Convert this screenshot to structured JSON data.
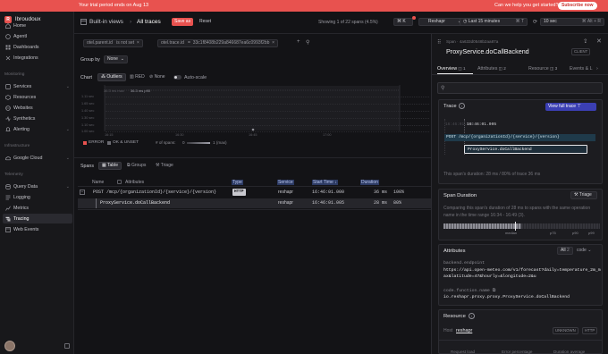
{
  "banner": {
    "message": "Your trial period ends on Aug 13",
    "question": "Can we help you get started?",
    "subscribe": "Subscribe now"
  },
  "sidebar": {
    "org_initial": "R",
    "org_name": "lbroudoux",
    "top_items": [
      {
        "label": "Home",
        "icon": "home-icon"
      },
      {
        "label": "AgentI",
        "icon": "agent-icon"
      },
      {
        "label": "Dashboards",
        "icon": "dashboard-icon"
      },
      {
        "label": "Integrations",
        "icon": "integrations-icon"
      }
    ],
    "monitoring_header": "Monitoring",
    "monitoring_items": [
      {
        "label": "Services",
        "icon": "services-icon",
        "chevron": "⌄"
      },
      {
        "label": "Resources",
        "icon": "resources-icon"
      },
      {
        "label": "Websites",
        "icon": "globe-icon"
      },
      {
        "label": "Synthetics",
        "icon": "synthetics-icon"
      },
      {
        "label": "Alerting",
        "icon": "bell-icon",
        "chevron": "⌄"
      }
    ],
    "infra_header": "Infrastructure",
    "infra_items": [
      {
        "label": "Google Cloud",
        "icon": "cloud-icon",
        "chevron": "⌄"
      }
    ],
    "telemetry_header": "Telemetry",
    "telemetry_items": [
      {
        "label": "Query Data",
        "icon": "database-icon",
        "chevron": "⌄"
      },
      {
        "label": "Logging",
        "icon": "logs-icon"
      },
      {
        "label": "Metrics",
        "icon": "metrics-icon"
      },
      {
        "label": "Tracing",
        "icon": "tracing-icon",
        "active": true
      },
      {
        "label": "Web Events",
        "icon": "web-events-icon"
      }
    ]
  },
  "topbar": {
    "views_label": "Built-in views",
    "crumb_sep": "›",
    "current_view": "All traces",
    "save_as": "Save as",
    "reset": "Reset",
    "showing": "Showing 1 of 22 spans (4.5%)",
    "kbd": "⌘ K",
    "project": "Reshapr",
    "time_range": "Last 15 minutes",
    "time_kbd": "⌘ T",
    "refresh": "10 sec",
    "refresh_kbd": "⌘ Alt + R"
  },
  "filters": {
    "f1_field": "otel.parent.id",
    "f1_op": "is not set",
    "f2_field": "otel.trace.id",
    "f2_op": "=",
    "f2_value": "33c1f8408b229a846687ea6c0993f2bb"
  },
  "groupby": {
    "label": "Group by",
    "value": "None"
  },
  "chart": {
    "label": "Chart",
    "modes": [
      "Outliers",
      "RED",
      "None"
    ],
    "autoscale": "Auto-scale",
    "y_ticks": [
      "1.11 sec",
      "1.65 sec",
      "1.40 sec",
      "1.30 sec",
      "1.10 sec",
      "1.00 sec"
    ],
    "x_ticks": [
      "16:15",
      "16:30",
      "16:45",
      "17:00"
    ],
    "annotation_p90": "36.3 ms p90",
    "annotation_left": "36.3 ms max",
    "legend": [
      {
        "label": "ERROR",
        "color": "#e8524f"
      },
      {
        "label": "OK & UNSET",
        "color": "#6b6b72"
      }
    ],
    "spans_label": "# of spans:",
    "spans_min": "0",
    "spans_max": "1 (max)"
  },
  "chart_data": {
    "type": "scatter",
    "x_ticks": [
      "16:15",
      "16:30",
      "16:45",
      "17:00"
    ],
    "series": [
      {
        "name": "OK & UNSET",
        "points": [
          {
            "x": "16:46",
            "y": 0.036
          }
        ]
      }
    ],
    "annotations": [
      "36.3 ms p90"
    ]
  },
  "spans": {
    "label": "Spans",
    "tabs": [
      "Table",
      "Groups",
      "Triage"
    ],
    "columns": [
      "Name",
      "Attributes",
      "Type",
      "Service",
      "Start Time",
      "Duration"
    ],
    "rows": [
      {
        "name": "POST /mcp/{organizationId}/{service}/{version}",
        "type": "HTTP",
        "service": "reshapr",
        "start": "16:46:01.000",
        "duration": "36 ms",
        "pct": "100%"
      },
      {
        "name": "ProxyService.doCallBackend",
        "type": "",
        "service": "reshapr",
        "start": "16:46:01.005",
        "duration": "28 ms",
        "pct": "80%"
      }
    ]
  },
  "panel": {
    "span_label": "Span",
    "span_id": "4a633d0548b2aa87a",
    "title": "ProxyService.doCallBackend",
    "kind": "CLIENT",
    "tabs": [
      "Overview",
      "Attributes",
      "Resource",
      "Events & L"
    ],
    "tab_counts": [
      "1",
      "2",
      "3",
      ""
    ],
    "trace_title": "Trace",
    "view_full": "View full trace",
    "trace_time_left": "16:46:01.000",
    "trace_time": "16:46:01.005",
    "trace_root": "POST /mcp/{organizationId}/{service}/{version}",
    "trace_child": "ProxyService.doCallBackend",
    "trace_summary": "This span's duration: 28 ms / 80% of trace 36 ms",
    "duration_title": "Span Duration",
    "triage": "Triage",
    "duration_text": "Comparing this span's duration of 28 ms to spans with the same operation name in the time range 16:34 - 16:49 (3).",
    "median": "median",
    "p75": "p75",
    "p90": "p90",
    "p99": "p99",
    "attributes_title": "Attributes",
    "attr_filter": "All",
    "attr_count": "2",
    "attr_sort": "code",
    "attr1_key": "backend.endpoint",
    "attr1_value": "https://api.open-meteo.com/v1/forecast?daily=temperature_2m_max&latitude=47&hourly=&longitude=2&u",
    "attr2_key": "code.function.name",
    "attr2_value": "io.reshapr.proxy.proxy.ProxyService.doCallBackend",
    "resource_title": "Resource",
    "resource_host_label": "Host",
    "resource_host": "reshapr",
    "resource_badge1": "UNKNOWN",
    "resource_badge2": "HTTP",
    "footer_cols": [
      "Request load",
      "Error percentage",
      "Duration average"
    ]
  }
}
